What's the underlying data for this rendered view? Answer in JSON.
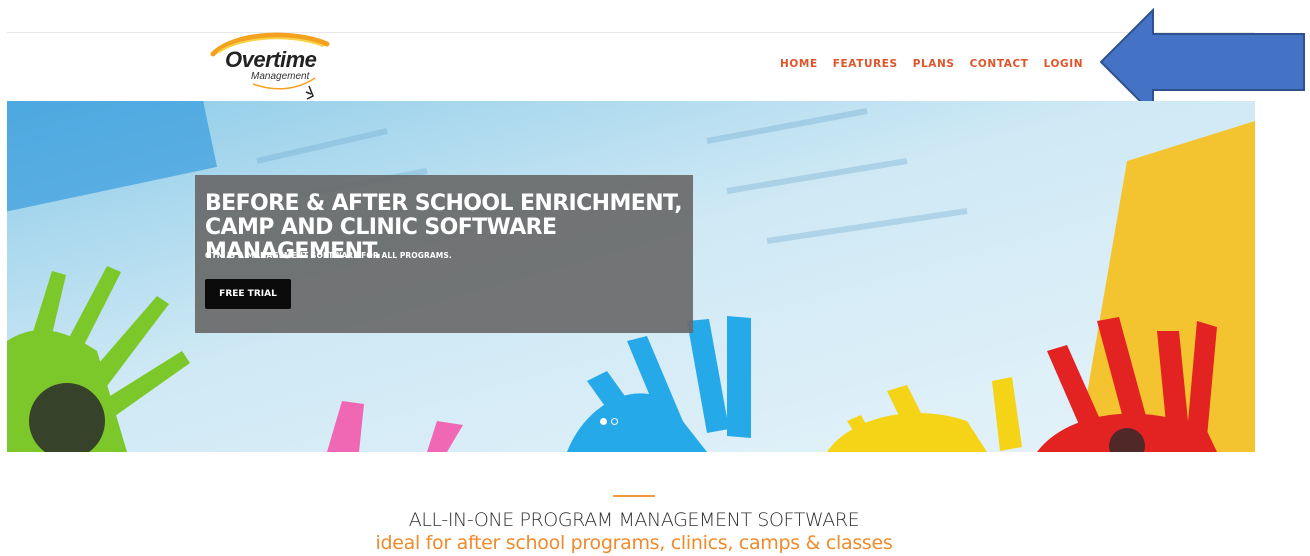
{
  "brand": {
    "logo_word": "Overtime",
    "logo_sub": "Management"
  },
  "nav": {
    "items": [
      "HOME",
      "FEATURES",
      "PLANS",
      "CONTACT",
      "LOGIN"
    ]
  },
  "hero": {
    "headline_line1": "BEFORE & AFTER SCHOOL ENRICHMENT,",
    "headline_line2": "CAMP AND CLINIC SOFTWARE MANAGEMENT.",
    "subheadline": "OTM IS A MANAGEMENT SOFTWARE FOR ALL PROGRAMS.",
    "cta_label": "FREE TRIAL",
    "slides_total": 2,
    "active_slide": 1
  },
  "section": {
    "heading": "ALL-IN-ONE PROGRAM MANAGEMENT SOFTWARE",
    "tagline": "ideal for after school programs, clinics, camps & classes"
  },
  "annotation": {
    "arrow_icon": "left-arrow-icon",
    "arrow_color": "#4472c4"
  },
  "colors": {
    "nav": "#e0542a",
    "accent": "#f08a2b",
    "caption_bg": "#696969",
    "cta_bg": "#0b0b0b"
  }
}
